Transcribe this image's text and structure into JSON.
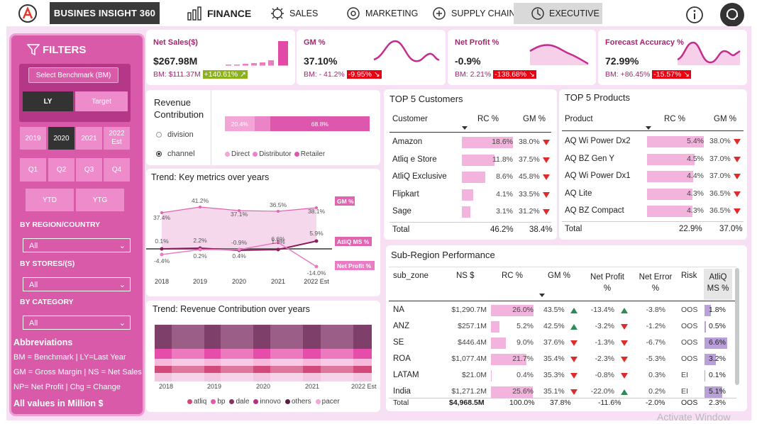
{
  "brand": "BUSINES INSIGHT 360",
  "nav": [
    {
      "label": "FINANCE",
      "icon": "finance-icon"
    },
    {
      "label": "SALES",
      "icon": "sales-icon"
    },
    {
      "label": "MARKETING",
      "icon": "marketing-icon"
    },
    {
      "label": "SUPPLY CHAIN",
      "icon": "supply-chain-icon"
    },
    {
      "label": "EXECUTIVE",
      "icon": "executive-icon"
    }
  ],
  "filters": {
    "title": "FILTERS",
    "benchmark_label": "Select Benchmark (BM)",
    "benchmark_options": [
      "LY",
      "Target"
    ],
    "years": [
      "2019",
      "2020",
      "2021",
      "2022 Est"
    ],
    "quarters": [
      "Q1",
      "Q2",
      "Q3",
      "Q4"
    ],
    "periods": [
      "YTD",
      "YTG"
    ],
    "region_label": "BY REGION/COUNTRY",
    "region_value": "All",
    "stores_label": "BY STORES/(S)",
    "stores_value": "All",
    "category_label": "BY CATEGORY",
    "category_value": "All",
    "abbr_title": "Abbreviations",
    "abbr_lines": [
      "BM = Benchmark | LY=Last Year",
      "GM = Gross Margin | NS = Net Sales",
      "NP= Net Profit | Chg = Change"
    ],
    "footer": "All values in Million $"
  },
  "kpis": [
    {
      "title": "Net Sales($)",
      "value": "$267.98M",
      "bm": "BM: $111.37M",
      "chg": "+140.61% ↗",
      "chg_color": "#8db11d"
    },
    {
      "title": "GM %",
      "value": "37.10%",
      "bm": "BM: - 41.2%",
      "chg": "-9.95% ↘",
      "chg_color": "#e60012"
    },
    {
      "title": "Net Profit %",
      "value": "-0.9%",
      "bm": "BM: 2.21%",
      "chg": "-138.68% ↘",
      "chg_color": "#e60012"
    },
    {
      "title": "Forecast Accuracy %",
      "value": "72.99%",
      "bm": "BM: +86.45%",
      "chg": "-15.57% ↘",
      "chg_color": "#e60012"
    }
  ],
  "revenue": {
    "title": "Revenue Contribution",
    "options": [
      "division",
      "channel"
    ],
    "selected": "channel",
    "segments": [
      {
        "label": "20.4%",
        "value": 20.4,
        "color": "#f2a5d6"
      },
      {
        "label": "",
        "value": 10.8,
        "color": "#ea84c6"
      },
      {
        "label": "68.8%",
        "value": 68.8,
        "color": "#dd58ad"
      }
    ],
    "legend": [
      {
        "name": "Direct",
        "color": "#f2a5d6"
      },
      {
        "name": "Distributor",
        "color": "#ea84c6"
      },
      {
        "name": "Retailer",
        "color": "#dd58ad"
      }
    ]
  },
  "trend": {
    "title": "Trend: Key metrics over years",
    "years": [
      "2018",
      "2019",
      "2020",
      "2021",
      "2022 Est"
    ],
    "gm": {
      "name": "GM %",
      "labels": [
        "37.4%",
        "41.2%",
        "37.1%",
        "36.5%",
        "38.1%"
      ]
    },
    "ms": {
      "name": "AtliQ MS %",
      "labels": [
        "0.1%",
        "2.2%",
        "-0.9%",
        "1.1%",
        "5.9%"
      ]
    },
    "np": {
      "name": "Net Profit %",
      "labels": [
        "-4.4%",
        "0.2%",
        "0.4%",
        "6.6%",
        "-14.0%"
      ]
    }
  },
  "trend_rev": {
    "title": "Trend: Revenue Contribution over years",
    "years": [
      "2018",
      "2019",
      "2020",
      "2021",
      "2022 Est"
    ],
    "legend": [
      {
        "name": "atliq",
        "color": "#d24a7a"
      },
      {
        "name": "bp",
        "color": "#e25aa7"
      },
      {
        "name": "dale",
        "color": "#8c2f63"
      },
      {
        "name": "innovo",
        "color": "#b0337d"
      },
      {
        "name": "others",
        "color": "#5f1a44"
      },
      {
        "name": "pacer",
        "color": "#f2a5d6"
      }
    ]
  },
  "customers": {
    "title": "TOP 5 Customers",
    "headers": [
      "Customer",
      "RC %",
      "GM %"
    ],
    "rows": [
      {
        "name": "Amazon",
        "rc": "18.6%",
        "rcv": 18.6,
        "gm": "38.0%"
      },
      {
        "name": "Atliq e Store",
        "rc": "11.8%",
        "rcv": 11.8,
        "gm": "37.5%"
      },
      {
        "name": "AtliQ Exclusive",
        "rc": "8.6%",
        "rcv": 8.6,
        "gm": "45.8%"
      },
      {
        "name": "Flipkart",
        "rc": "4.1%",
        "rcv": 4.1,
        "gm": "33.5%"
      },
      {
        "name": "Sage",
        "rc": "3.1%",
        "rcv": 3.1,
        "gm": "31.2%"
      }
    ],
    "total": {
      "label": "Total",
      "rc": "46.2%",
      "gm": "38.4%"
    }
  },
  "products": {
    "title": "TOP 5 Products",
    "headers": [
      "Product",
      "RC %",
      "GM %"
    ],
    "rows": [
      {
        "name": "AQ Wi Power Dx2",
        "rc": "5.4%",
        "rcv": 5.4,
        "gm": "38.0%"
      },
      {
        "name": "AQ BZ Gen Y",
        "rc": "4.5%",
        "rcv": 4.5,
        "gm": "37.0%"
      },
      {
        "name": "AQ Wi Power Dx1",
        "rc": "4.4%",
        "rcv": 4.4,
        "gm": "37.0%"
      },
      {
        "name": "AQ Lite",
        "rc": "4.3%",
        "rcv": 4.3,
        "gm": "36.5%"
      },
      {
        "name": "AQ BZ Compact",
        "rc": "4.3%",
        "rcv": 4.3,
        "gm": "36.5%"
      }
    ],
    "total": {
      "label": "Total",
      "rc": "22.9%",
      "gm": "37.0%"
    }
  },
  "subregion": {
    "title": "Sub-Region Performance",
    "headers": [
      "sub_zone",
      "NS $",
      "RC %",
      "GM %",
      "Net Profit %",
      "Net Error %",
      "Risk",
      "AtliQ MS %"
    ],
    "rows": [
      {
        "zone": "NA",
        "ns": "$1,290.7M",
        "rc": "26.0%",
        "rcv": 26.0,
        "gm": "43.5%",
        "gm_up": true,
        "np": "-13.4%",
        "np_up": true,
        "ne": "-3.8%",
        "risk": "OOS",
        "ms": "1.8%",
        "msv": 1.8
      },
      {
        "zone": "ANZ",
        "ns": "$257.1M",
        "rc": "5.2%",
        "rcv": 5.2,
        "gm": "42.5%",
        "gm_up": true,
        "np": "-3.2%",
        "np_up": false,
        "ne": "-1.2%",
        "risk": "OOS",
        "ms": "0.5%",
        "msv": 0.5
      },
      {
        "zone": "SE",
        "ns": "$446.4M",
        "rc": "9.0%",
        "rcv": 9.0,
        "gm": "37.6%",
        "gm_up": false,
        "np": "-1.3%",
        "np_up": false,
        "ne": "-6.7%",
        "risk": "OOS",
        "ms": "6.6%",
        "msv": 6.6
      },
      {
        "zone": "ROA",
        "ns": "$1,077.4M",
        "rc": "21.7%",
        "rcv": 21.7,
        "gm": "35.4%",
        "gm_up": false,
        "np": "-2.3%",
        "np_up": false,
        "ne": "-5.3%",
        "risk": "OOS",
        "ms": "3.2%",
        "msv": 3.2
      },
      {
        "zone": "LATAM",
        "ns": "$21.0M",
        "rc": "0.4%",
        "rcv": 0.4,
        "gm": "35.3%",
        "gm_up": false,
        "np": "-0.8%",
        "np_up": false,
        "ne": "0.3%",
        "risk": "EI",
        "ms": "0.1%",
        "msv": 0.1
      },
      {
        "zone": "India",
        "ns": "$1,271.2M",
        "rc": "25.6%",
        "rcv": 25.6,
        "gm": "35.1%",
        "gm_up": false,
        "np": "-22.0%",
        "np_up": true,
        "ne": "0.2%",
        "risk": "EI",
        "ms": "5.1%",
        "msv": 5.1
      }
    ],
    "total": {
      "zone": "Total",
      "ns": "$4,968.5M",
      "rc": "100.0%",
      "gm": "37.8%",
      "np": "-11.6%",
      "ne": "-2.0%",
      "risk": "OOS",
      "ms": "2.3%"
    }
  },
  "watermark": "Activate Window"
}
